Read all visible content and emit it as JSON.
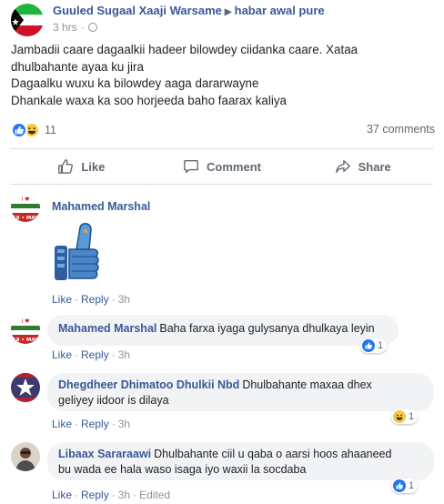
{
  "post": {
    "author": "Guuled Sugaal Xaaji Warsame",
    "group": "habar awal pure",
    "time": "3 hrs",
    "lines": [
      "Jambadii caare dagaalkii hadeer bilowdey ciidanka caare. Xataa",
      "dhulbahante ayaa ku jira",
      "Dagaalku wuxu ka bilowdey aaga dararwayne",
      "Dhankale waxa ka soo horjeeda baho faarax kaliya"
    ],
    "reaction_count": "11",
    "comments_count": "37 comments"
  },
  "actions": {
    "like": "Like",
    "comment": "Comment",
    "share": "Share"
  },
  "comments": [
    {
      "name": "Mahamed Marshal",
      "text": "",
      "like": "Like",
      "reply": "Reply",
      "time": "3h",
      "avatar_text": "18 • MAY",
      "sticker": "thumbs-up-robot-sticker"
    },
    {
      "name": "Mahamed Marshal",
      "text": "Baha farxa iyaga gulysanya dhulkaya leyin",
      "like": "Like",
      "reply": "Reply",
      "time": "3h",
      "reaction_count": "1",
      "avatar_text": "18 • MAY"
    },
    {
      "name": "Dhegdheer Dhimatoo Dhulkii Nbd",
      "text_line1": "Dhulbahante maxaa dhex",
      "text_line2": "geliyey iidoor is dilaya",
      "like": "Like",
      "reply": "Reply",
      "time": "3h",
      "reaction_count": "1"
    },
    {
      "name": "Libaax Sararaawi",
      "text_line1": "Dhulbahante ciil u qaba o aarsi hoos ahaaneed",
      "text_line2": "bu wada ee hala waso isaga iyo waxii la socdaba",
      "like": "Like",
      "reply": "Reply",
      "time": "3h",
      "edited": "Edited",
      "reaction_count": "1"
    }
  ],
  "colors": {
    "link": "#385898",
    "meta": "#90949c",
    "like_blue": "#2078f4",
    "haha_yellow": "#f7c942",
    "bubble": "#f2f3f5"
  }
}
